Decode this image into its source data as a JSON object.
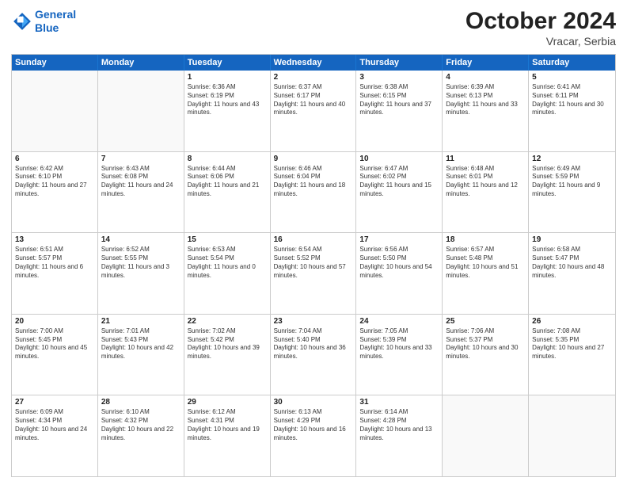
{
  "header": {
    "logo_line1": "General",
    "logo_line2": "Blue",
    "month": "October 2024",
    "location": "Vracar, Serbia"
  },
  "days_of_week": [
    "Sunday",
    "Monday",
    "Tuesday",
    "Wednesday",
    "Thursday",
    "Friday",
    "Saturday"
  ],
  "weeks": [
    [
      {
        "day": "",
        "empty": true
      },
      {
        "day": "",
        "empty": true
      },
      {
        "day": "1",
        "sunrise": "Sunrise: 6:36 AM",
        "sunset": "Sunset: 6:19 PM",
        "daylight": "Daylight: 11 hours and 43 minutes."
      },
      {
        "day": "2",
        "sunrise": "Sunrise: 6:37 AM",
        "sunset": "Sunset: 6:17 PM",
        "daylight": "Daylight: 11 hours and 40 minutes."
      },
      {
        "day": "3",
        "sunrise": "Sunrise: 6:38 AM",
        "sunset": "Sunset: 6:15 PM",
        "daylight": "Daylight: 11 hours and 37 minutes."
      },
      {
        "day": "4",
        "sunrise": "Sunrise: 6:39 AM",
        "sunset": "Sunset: 6:13 PM",
        "daylight": "Daylight: 11 hours and 33 minutes."
      },
      {
        "day": "5",
        "sunrise": "Sunrise: 6:41 AM",
        "sunset": "Sunset: 6:11 PM",
        "daylight": "Daylight: 11 hours and 30 minutes."
      }
    ],
    [
      {
        "day": "6",
        "sunrise": "Sunrise: 6:42 AM",
        "sunset": "Sunset: 6:10 PM",
        "daylight": "Daylight: 11 hours and 27 minutes."
      },
      {
        "day": "7",
        "sunrise": "Sunrise: 6:43 AM",
        "sunset": "Sunset: 6:08 PM",
        "daylight": "Daylight: 11 hours and 24 minutes."
      },
      {
        "day": "8",
        "sunrise": "Sunrise: 6:44 AM",
        "sunset": "Sunset: 6:06 PM",
        "daylight": "Daylight: 11 hours and 21 minutes."
      },
      {
        "day": "9",
        "sunrise": "Sunrise: 6:46 AM",
        "sunset": "Sunset: 6:04 PM",
        "daylight": "Daylight: 11 hours and 18 minutes."
      },
      {
        "day": "10",
        "sunrise": "Sunrise: 6:47 AM",
        "sunset": "Sunset: 6:02 PM",
        "daylight": "Daylight: 11 hours and 15 minutes."
      },
      {
        "day": "11",
        "sunrise": "Sunrise: 6:48 AM",
        "sunset": "Sunset: 6:01 PM",
        "daylight": "Daylight: 11 hours and 12 minutes."
      },
      {
        "day": "12",
        "sunrise": "Sunrise: 6:49 AM",
        "sunset": "Sunset: 5:59 PM",
        "daylight": "Daylight: 11 hours and 9 minutes."
      }
    ],
    [
      {
        "day": "13",
        "sunrise": "Sunrise: 6:51 AM",
        "sunset": "Sunset: 5:57 PM",
        "daylight": "Daylight: 11 hours and 6 minutes."
      },
      {
        "day": "14",
        "sunrise": "Sunrise: 6:52 AM",
        "sunset": "Sunset: 5:55 PM",
        "daylight": "Daylight: 11 hours and 3 minutes."
      },
      {
        "day": "15",
        "sunrise": "Sunrise: 6:53 AM",
        "sunset": "Sunset: 5:54 PM",
        "daylight": "Daylight: 11 hours and 0 minutes."
      },
      {
        "day": "16",
        "sunrise": "Sunrise: 6:54 AM",
        "sunset": "Sunset: 5:52 PM",
        "daylight": "Daylight: 10 hours and 57 minutes."
      },
      {
        "day": "17",
        "sunrise": "Sunrise: 6:56 AM",
        "sunset": "Sunset: 5:50 PM",
        "daylight": "Daylight: 10 hours and 54 minutes."
      },
      {
        "day": "18",
        "sunrise": "Sunrise: 6:57 AM",
        "sunset": "Sunset: 5:48 PM",
        "daylight": "Daylight: 10 hours and 51 minutes."
      },
      {
        "day": "19",
        "sunrise": "Sunrise: 6:58 AM",
        "sunset": "Sunset: 5:47 PM",
        "daylight": "Daylight: 10 hours and 48 minutes."
      }
    ],
    [
      {
        "day": "20",
        "sunrise": "Sunrise: 7:00 AM",
        "sunset": "Sunset: 5:45 PM",
        "daylight": "Daylight: 10 hours and 45 minutes."
      },
      {
        "day": "21",
        "sunrise": "Sunrise: 7:01 AM",
        "sunset": "Sunset: 5:43 PM",
        "daylight": "Daylight: 10 hours and 42 minutes."
      },
      {
        "day": "22",
        "sunrise": "Sunrise: 7:02 AM",
        "sunset": "Sunset: 5:42 PM",
        "daylight": "Daylight: 10 hours and 39 minutes."
      },
      {
        "day": "23",
        "sunrise": "Sunrise: 7:04 AM",
        "sunset": "Sunset: 5:40 PM",
        "daylight": "Daylight: 10 hours and 36 minutes."
      },
      {
        "day": "24",
        "sunrise": "Sunrise: 7:05 AM",
        "sunset": "Sunset: 5:39 PM",
        "daylight": "Daylight: 10 hours and 33 minutes."
      },
      {
        "day": "25",
        "sunrise": "Sunrise: 7:06 AM",
        "sunset": "Sunset: 5:37 PM",
        "daylight": "Daylight: 10 hours and 30 minutes."
      },
      {
        "day": "26",
        "sunrise": "Sunrise: 7:08 AM",
        "sunset": "Sunset: 5:35 PM",
        "daylight": "Daylight: 10 hours and 27 minutes."
      }
    ],
    [
      {
        "day": "27",
        "sunrise": "Sunrise: 6:09 AM",
        "sunset": "Sunset: 4:34 PM",
        "daylight": "Daylight: 10 hours and 24 minutes."
      },
      {
        "day": "28",
        "sunrise": "Sunrise: 6:10 AM",
        "sunset": "Sunset: 4:32 PM",
        "daylight": "Daylight: 10 hours and 22 minutes."
      },
      {
        "day": "29",
        "sunrise": "Sunrise: 6:12 AM",
        "sunset": "Sunset: 4:31 PM",
        "daylight": "Daylight: 10 hours and 19 minutes."
      },
      {
        "day": "30",
        "sunrise": "Sunrise: 6:13 AM",
        "sunset": "Sunset: 4:29 PM",
        "daylight": "Daylight: 10 hours and 16 minutes."
      },
      {
        "day": "31",
        "sunrise": "Sunrise: 6:14 AM",
        "sunset": "Sunset: 4:28 PM",
        "daylight": "Daylight: 10 hours and 13 minutes."
      },
      {
        "day": "",
        "empty": true
      },
      {
        "day": "",
        "empty": true
      }
    ]
  ]
}
